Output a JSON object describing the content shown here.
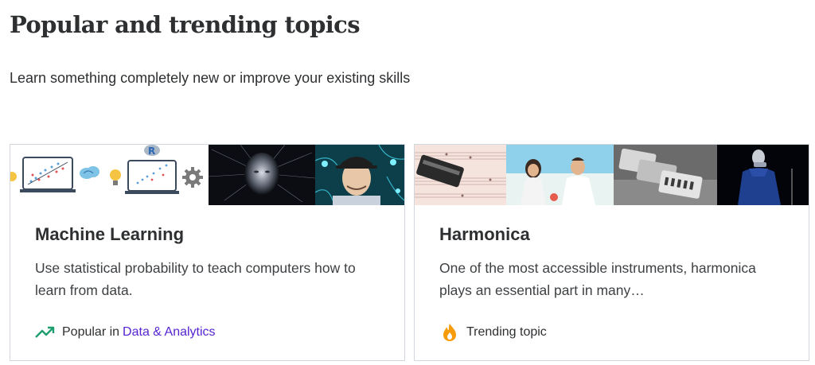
{
  "heading": "Popular and trending topics",
  "subheading": "Learn something completely new or improve your existing skills",
  "cards": [
    {
      "title": "Machine Learning",
      "description": "Use statistical probability to teach computers how to learn from data.",
      "footer_prefix": "Popular in",
      "footer_link": "Data & Analytics",
      "footer_icon": "trending-up-icon",
      "icon_color": "#1e9e6f"
    },
    {
      "title": "Harmonica",
      "description": "One of the most accessible instruments, harmonica plays an essential part in many…",
      "footer_text": "Trending topic",
      "footer_icon": "flame-icon",
      "icon_color": "#f69c08"
    }
  ]
}
